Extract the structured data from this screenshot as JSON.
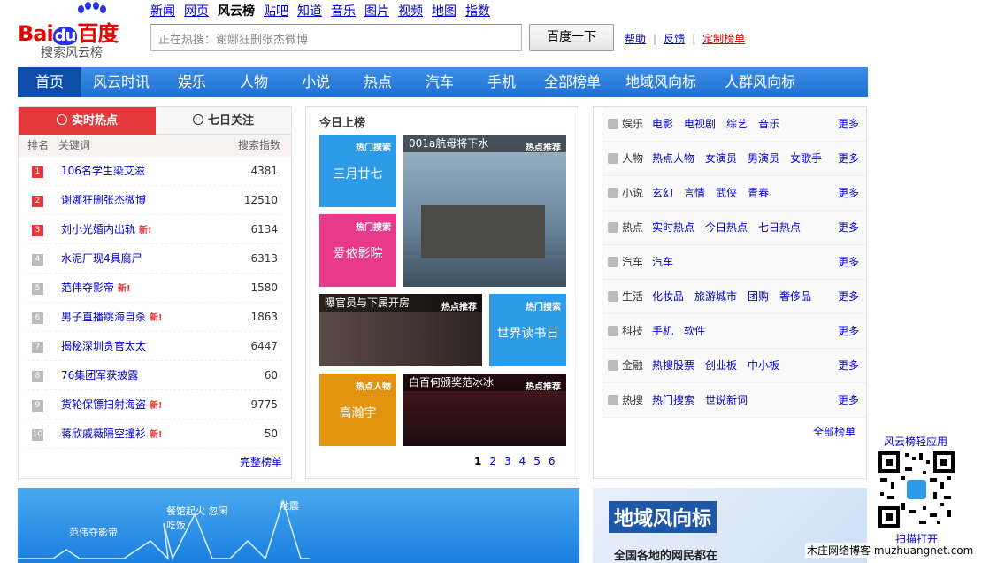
{
  "logo": {
    "bai": "Bai",
    "du": "du",
    "cn": "百度",
    "sub": "搜索风云榜"
  },
  "topnav": [
    "新闻",
    "网页",
    "风云榜",
    "贴吧",
    "知道",
    "音乐",
    "图片",
    "视频",
    "地图",
    "指数"
  ],
  "topnav_current": "风云榜",
  "search": {
    "placeholder": "正在热搜：谢娜狂删张杰微博",
    "button": "百度一下"
  },
  "header_links": {
    "help": "帮助",
    "feedback": "反馈",
    "custom": "定制榜单"
  },
  "mainnav": [
    "首页",
    "风云时讯",
    "娱乐",
    "人物",
    "小说",
    "热点",
    "汽车",
    "手机",
    "全部榜单",
    "地域风向标",
    "人群风向标"
  ],
  "hot": {
    "tab_realtime": "实时热点",
    "tab_week": "七日关注",
    "col_rank": "排名",
    "col_keyword": "关键词",
    "col_index": "搜索指数",
    "new_label": "新!",
    "rows": [
      {
        "rank": "1",
        "keyword": "106名学生染艾滋",
        "index": "4381",
        "new": false
      },
      {
        "rank": "2",
        "keyword": "谢娜狂删张杰微博",
        "index": "12510",
        "new": false
      },
      {
        "rank": "3",
        "keyword": "刘小光婚内出轨",
        "index": "6134",
        "new": true
      },
      {
        "rank": "4",
        "keyword": "水泥厂现4具腐尸",
        "index": "6313",
        "new": false
      },
      {
        "rank": "5",
        "keyword": "范伟夺影帝",
        "index": "1580",
        "new": true
      },
      {
        "rank": "6",
        "keyword": "男子直播跳海自杀",
        "index": "1863",
        "new": true
      },
      {
        "rank": "7",
        "keyword": "揭秘深圳贪官太太",
        "index": "6447",
        "new": false
      },
      {
        "rank": "8",
        "keyword": "76集团军获披露",
        "index": "60",
        "new": false
      },
      {
        "rank": "9",
        "keyword": "货轮保镖扫射海盗",
        "index": "9775",
        "new": true
      },
      {
        "rank": "10",
        "keyword": "蒋欣戚薇隔空撞衫",
        "index": "50",
        "new": true
      }
    ],
    "full_list": "完整榜单"
  },
  "today": {
    "title": "今日上榜",
    "tag_hot_search": "热门搜索",
    "tag_hot_rec": "热点推荐",
    "tag_hot_person": "热点人物",
    "tile1": "三月廿七",
    "tile2": "爱依影院",
    "tile3_cap": "001a航母将下水",
    "tile4_cap": "曝官员与下属开房",
    "tile5": "世界读书日",
    "tile6": "高瀚宇",
    "tile7_cap": "白百何颁奖范冰冰",
    "pages": [
      "1",
      "2",
      "3",
      "4",
      "5",
      "6"
    ]
  },
  "categories": [
    {
      "name": "娱乐",
      "items": [
        "电影",
        "电视剧",
        "综艺",
        "音乐"
      ]
    },
    {
      "name": "人物",
      "items": [
        "热点人物",
        "女演员",
        "男演员",
        "女歌手"
      ]
    },
    {
      "name": "小说",
      "items": [
        "玄幻",
        "言情",
        "武侠",
        "青春"
      ]
    },
    {
      "name": "热点",
      "items": [
        "实时热点",
        "今日热点",
        "七日热点"
      ]
    },
    {
      "name": "汽车",
      "items": [
        "汽车"
      ]
    },
    {
      "name": "生活",
      "items": [
        "化妆品",
        "旅游城市",
        "团购",
        "奢侈品"
      ]
    },
    {
      "name": "科技",
      "items": [
        "手机",
        "软件"
      ]
    },
    {
      "name": "金融",
      "items": [
        "热搜股票",
        "创业板",
        "中小板"
      ]
    },
    {
      "name": "热搜",
      "items": [
        "热门搜索",
        "世说新词"
      ]
    }
  ],
  "more": "更多",
  "all_lists": "全部榜单",
  "banner_wave": {
    "label1": "范伟夺影帝",
    "label2": "餐馆起火 忽闲 吃饭",
    "label3": "地震"
  },
  "region": {
    "title": "地域风向标",
    "sub": "全国各地的网民都在"
  },
  "qr": {
    "title": "风云榜轻应用",
    "scan": "扫描打开"
  },
  "watermark": "木庄网络博客 muzhuangnet.com",
  "colors": {
    "accent_red": "#e4393c",
    "nav_blue": "#1f6fd2",
    "link": "#0000cc"
  }
}
